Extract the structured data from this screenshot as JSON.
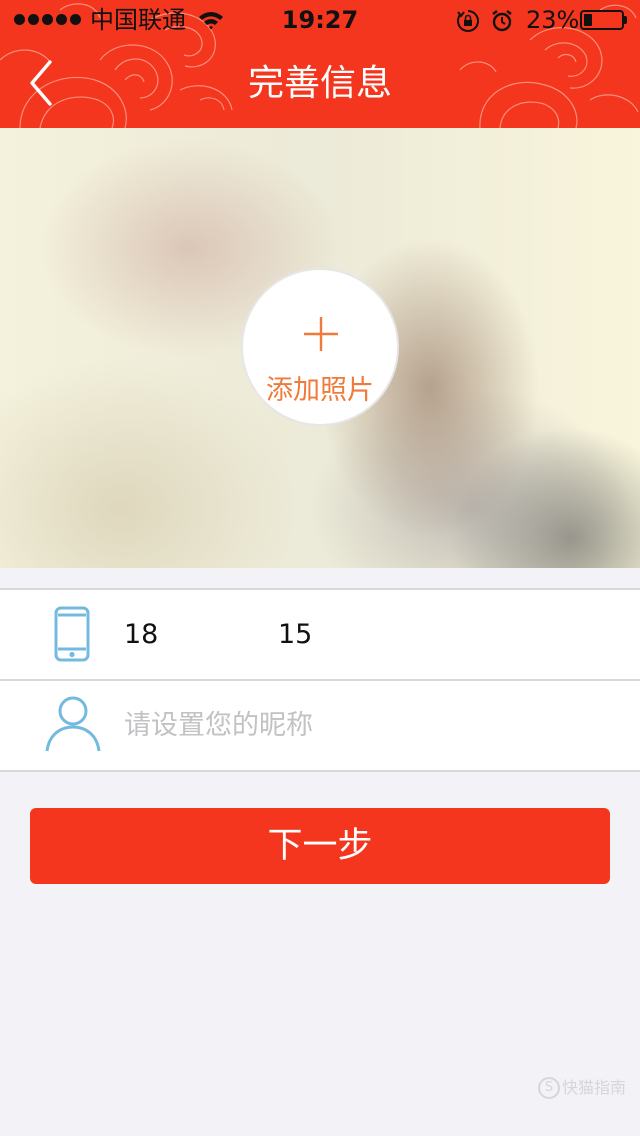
{
  "status_bar": {
    "carrier": "中国联通",
    "time": "19:27",
    "battery": "23%",
    "battery_level": 0.23
  },
  "nav": {
    "back_icon": "chevron-left-icon",
    "title": "完善信息"
  },
  "photo": {
    "add_icon": "plus-icon",
    "add_label": "添加照片"
  },
  "form": {
    "phone": {
      "icon": "phone-icon",
      "prefix": "18",
      "suffix": "15"
    },
    "nickname": {
      "icon": "user-icon",
      "placeholder": "请设置您的昵称",
      "value": ""
    }
  },
  "next_button": "下一步",
  "watermark": {
    "badge": "S",
    "text": "快猫指南"
  },
  "colors": {
    "brand_red": "#f3361d",
    "accent_orange": "#f07a3a",
    "icon_blue": "#74b9df",
    "background": "#f3f2f7"
  }
}
